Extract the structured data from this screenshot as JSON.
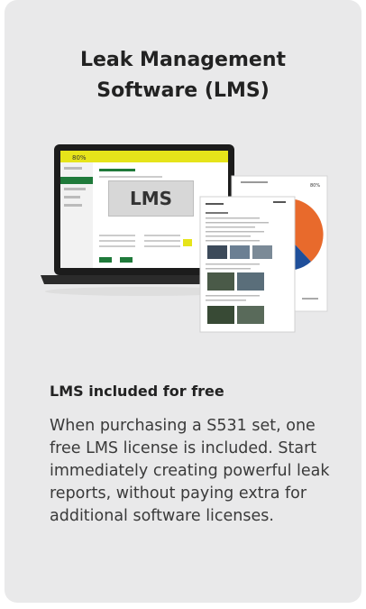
{
  "card": {
    "title_line1": "Leak Management",
    "title_line2": "Software (LMS)",
    "illustration": {
      "badge_label": "LMS",
      "screen_header": "80%",
      "pie_colors": [
        "#e86a2c",
        "#1f4f9a"
      ],
      "accent_color": "#e6e41a",
      "green_color": "#1f7a3a"
    },
    "subheading": "LMS included for free",
    "body_text": "When purchasing a S531 set, one free LMS license is included. Start immediately creating powerful leak reports, without paying extra for additional software licenses."
  }
}
